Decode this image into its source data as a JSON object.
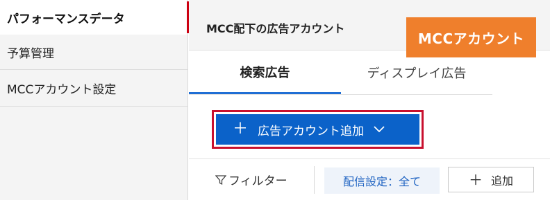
{
  "sidebar": {
    "items": [
      {
        "label": "パフォーマンスデータ",
        "active": true
      },
      {
        "label": "予算管理"
      },
      {
        "label": "MCCアカウント設定"
      }
    ]
  },
  "header": {
    "title": "MCC配下の広告アカウント",
    "badge": "MCCアカウント"
  },
  "tabs": [
    {
      "label": "検索広告",
      "selected": true
    },
    {
      "label": "ディスプレイ広告"
    }
  ],
  "toolbar": {
    "add_account_label": "広告アカウント追加"
  },
  "filters": {
    "filter_label": "フィルター",
    "chip_label": "配信設定：全て",
    "add_label": "追加"
  },
  "colors": {
    "accent_blue": "#0b62c9",
    "highlight_red": "#c8102e",
    "badge_orange": "#ef7f2c",
    "active_marker": "#cc0011"
  }
}
